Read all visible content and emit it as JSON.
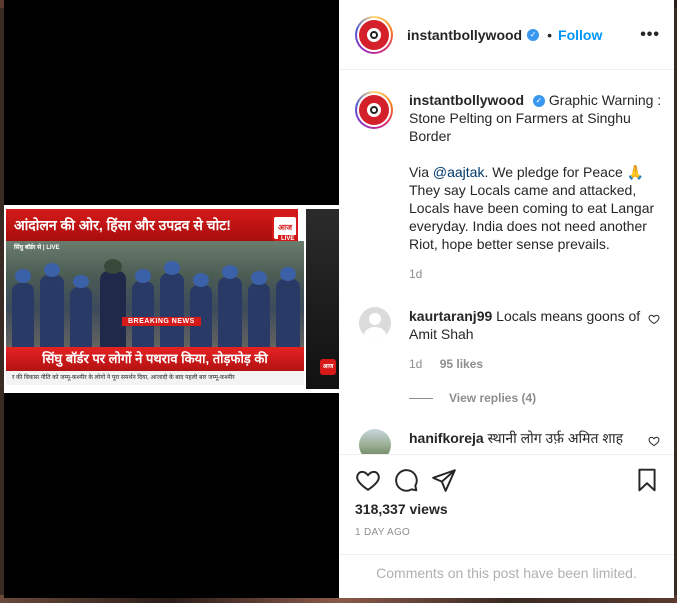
{
  "post": {
    "username": "instantbollywood",
    "follow_label": "Follow",
    "separator": "•",
    "more_label": "•••"
  },
  "video": {
    "headline": "आंदोलन की ओर, हिंसा और उपद्रव से चोट!",
    "location": "सिंघु बॉर्डर से | LIVE",
    "breaking": "BREAKING NEWS",
    "bottom_line": "सिंघु बॉर्डर पर लोगों ने पथराव किया, तोड़फोड़ की",
    "ticker": "र की विकास नीति को जम्मू-कश्मीर के लोगों ने पूरा समर्थन दिया, आजादी के बाद पहली बार जम्मू-कश्मीर",
    "channel_logo_text": "आज तक",
    "live_label": "LIVE",
    "corner_logo_text": "आज"
  },
  "caption": {
    "username": "instantbollywood",
    "line1": "Graphic Warning : Stone Pelting on Farmers at Singhu Border",
    "via": "Via ",
    "mention": "@aajtak",
    "line2": ". We pledge for Peace 🙏 They say Locals came and attacked, Locals have been coming to eat Langar everyday. India does not need another Riot, hope better sense prevails.",
    "age": "1d"
  },
  "comments": [
    {
      "username": "kaurtaranj99",
      "text": "Locals means goons of Amit Shah",
      "age": "1d",
      "likes": "95 likes",
      "view_replies": "View replies (4)"
    },
    {
      "username": "hanifkoreja",
      "text": "स्थानी लोग उर्फ़ अमित शाह"
    }
  ],
  "actions": {
    "views": "318,337 views",
    "posted": "1 DAY AGO",
    "comments_limited": "Comments on this post have been limited."
  },
  "icons": {
    "like": "heart-icon",
    "comment": "comment-icon",
    "share": "share-icon",
    "save": "bookmark-icon",
    "verified": "verified-badge-icon",
    "more": "more-options-icon"
  }
}
